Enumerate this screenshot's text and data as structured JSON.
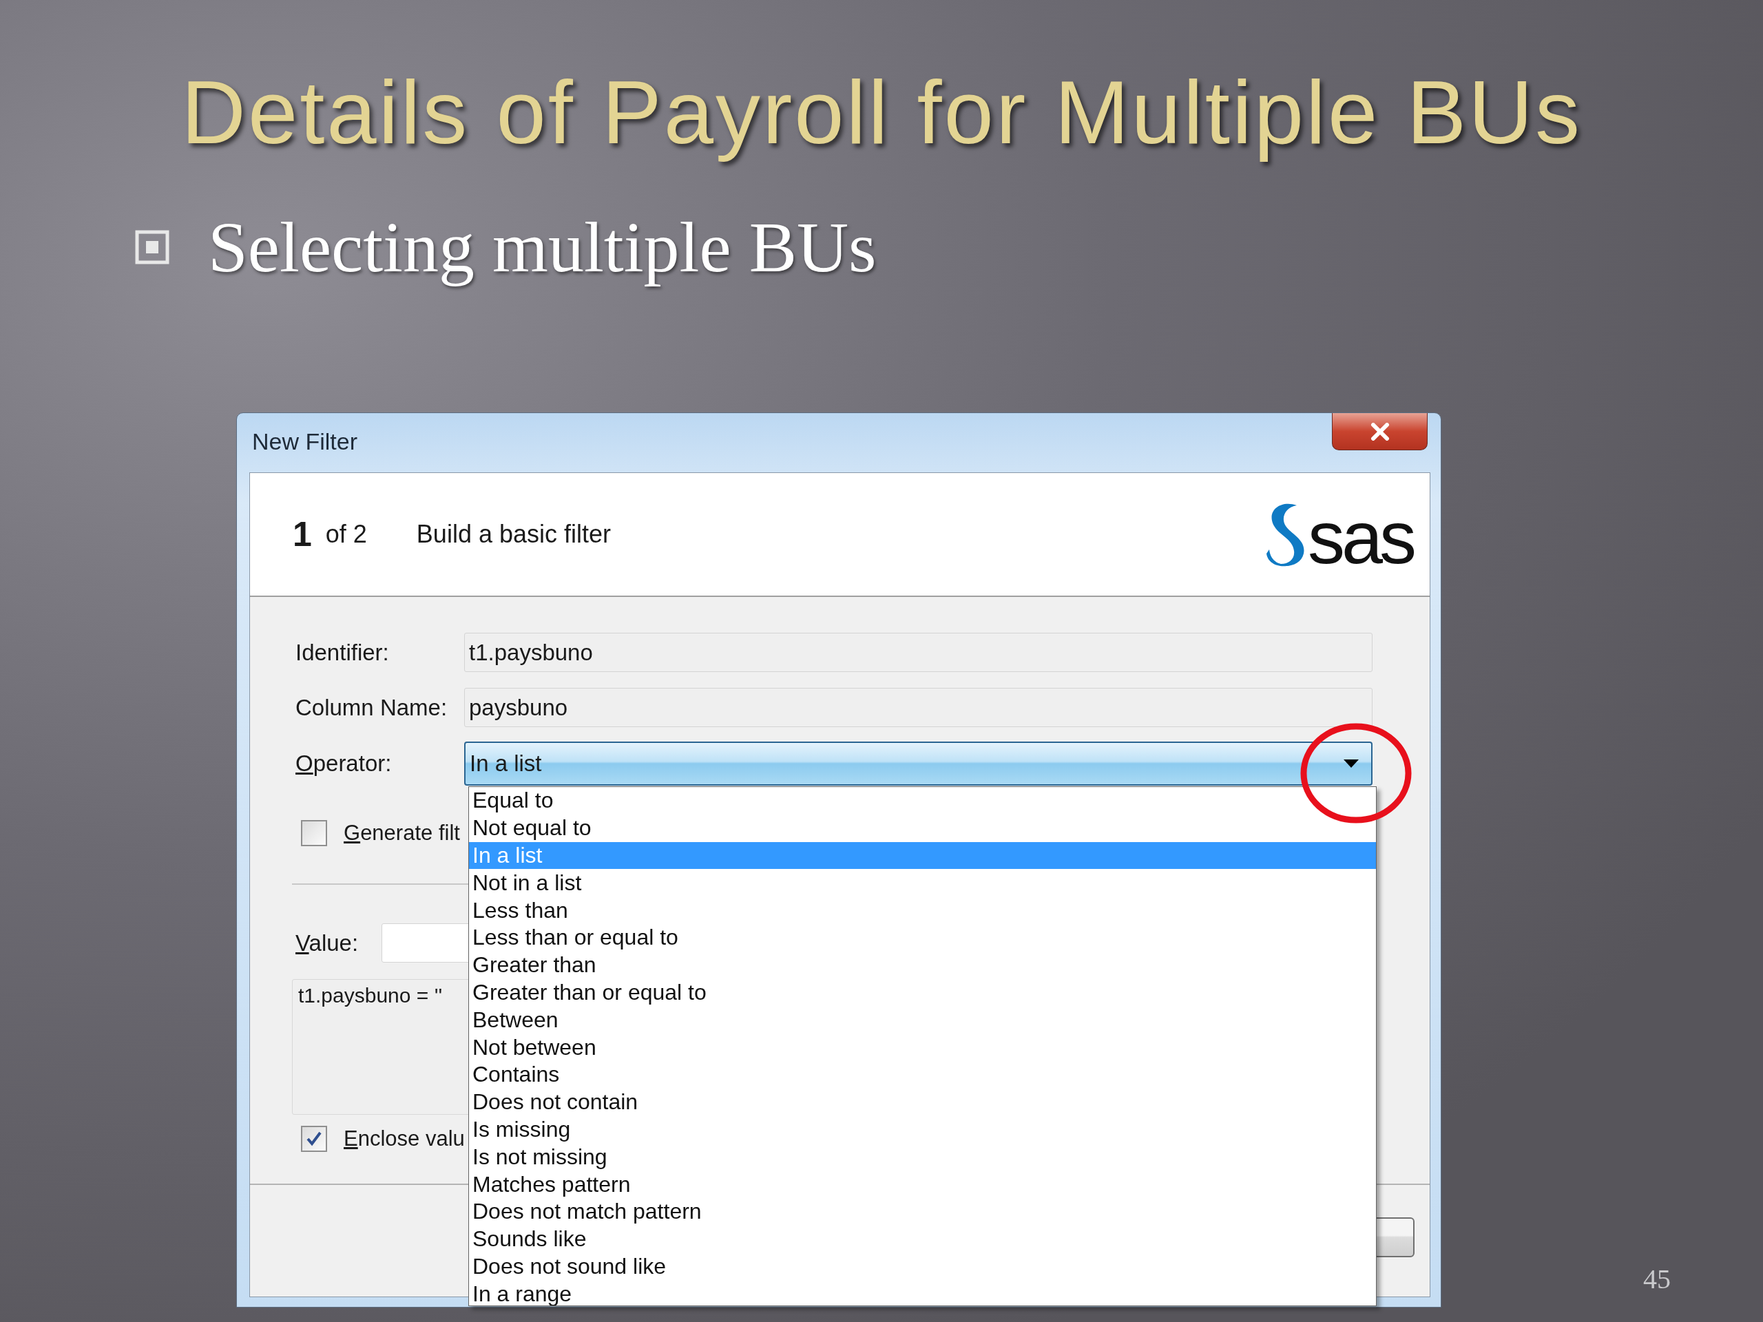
{
  "slide": {
    "title": "Details of Payroll for Multiple BUs",
    "bullets": [
      {
        "text": "Selecting multiple BUs"
      }
    ],
    "page_number": "45"
  },
  "dialog": {
    "title": "New Filter",
    "step": "1",
    "step_total": "of 2",
    "heading": "Build a basic filter",
    "logo_text": "sas",
    "fields": [
      {
        "label": "Identifier:",
        "value": "t1.paysbuno"
      },
      {
        "label": "Column Name:",
        "value": "paysbuno"
      }
    ],
    "operator": {
      "label": "Operator:",
      "value": "In a list",
      "expanded": true,
      "options": [
        {
          "label": "Equal to",
          "selected": false
        },
        {
          "label": "Not equal to",
          "selected": false
        },
        {
          "label": "In a list",
          "selected": true
        },
        {
          "label": "Not in a list",
          "selected": false
        },
        {
          "label": "Less than",
          "selected": false
        },
        {
          "label": "Less than or equal to",
          "selected": false
        },
        {
          "label": "Greater than",
          "selected": false
        },
        {
          "label": "Greater than or equal to",
          "selected": false
        },
        {
          "label": "Between",
          "selected": false
        },
        {
          "label": "Not between",
          "selected": false
        },
        {
          "label": "Contains",
          "selected": false
        },
        {
          "label": "Does not contain",
          "selected": false
        },
        {
          "label": "Is missing",
          "selected": false
        },
        {
          "label": "Is not missing",
          "selected": false
        },
        {
          "label": "Matches pattern",
          "selected": false
        },
        {
          "label": "Does not match pattern",
          "selected": false
        },
        {
          "label": "Sounds like",
          "selected": false
        },
        {
          "label": "Does not sound like",
          "selected": false
        },
        {
          "label": "In a range",
          "selected": false
        }
      ]
    },
    "generate_filter": {
      "label": "Generate filt",
      "checked": false
    },
    "value": {
      "label": "Value:"
    },
    "expression": "t1.paysbuno = ''",
    "enclose_values": {
      "label": "Enclose valu",
      "checked": true
    }
  }
}
